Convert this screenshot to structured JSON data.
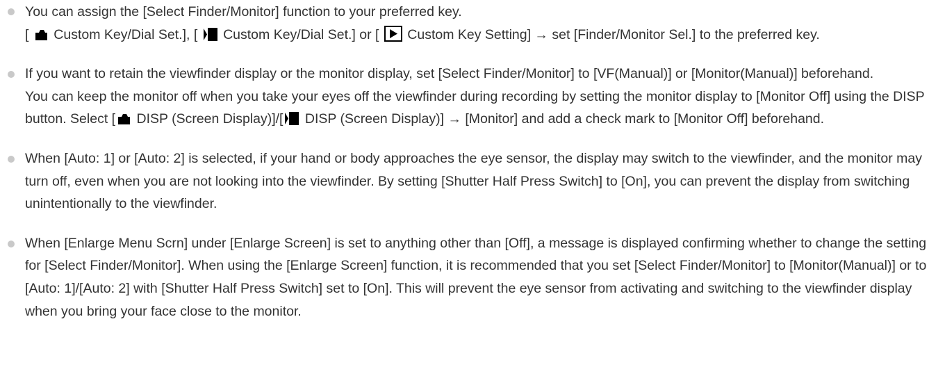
{
  "notes": [
    {
      "p1": "You can assign the [Select Finder/Monitor] function to your preferred key.",
      "p2_a": "[ ",
      "icon_a": "camera-icon",
      "p2_b": " Custom Key/Dial Set.], [ ",
      "icon_b": "movie-icon",
      "p2_c": " Custom Key/Dial Set.] or [ ",
      "icon_c": "playback-icon",
      "p2_d": " Custom Key Setting] → set [Finder/Monitor Sel.] to the preferred key."
    },
    {
      "p1": "If you want to retain the viewfinder display or the monitor display, set [Select Finder/Monitor] to [VF(Manual)] or [Monitor(Manual)] beforehand.",
      "p2": "You can keep the monitor off when you take your eyes off the viewfinder during recording by setting the monitor display to [Monitor Off] using the DISP button. Select [",
      "icon_a": "camera-icon",
      "p3": " DISP (Screen Display)]/[",
      "icon_b": "movie-icon",
      "p4": " DISP (Screen Display)] → [Monitor] and add a check mark to [Monitor Off] beforehand."
    },
    {
      "p1": "When [Auto: 1] or [Auto: 2] is selected, if your hand or body approaches the eye sensor, the display may switch to the viewfinder, and the monitor may turn off, even when you are not looking into the viewfinder. By setting [Shutter Half Press Switch] to [On], you can prevent the display from switching unintentionally to the viewfinder."
    },
    {
      "p1": "When [Enlarge Menu Scrn] under [Enlarge Screen] is set to anything other than [Off], a message is displayed confirming whether to change the setting for [Select Finder/Monitor]. When using the [Enlarge Screen] function, it is recommended that you set [Select Finder/Monitor] to [Monitor(Manual)] or to [Auto: 1]/[Auto: 2] with [Shutter Half Press Switch] set to [On]. This will prevent the eye sensor from activating and switching to the viewfinder display when you bring your face close to the monitor."
    }
  ]
}
